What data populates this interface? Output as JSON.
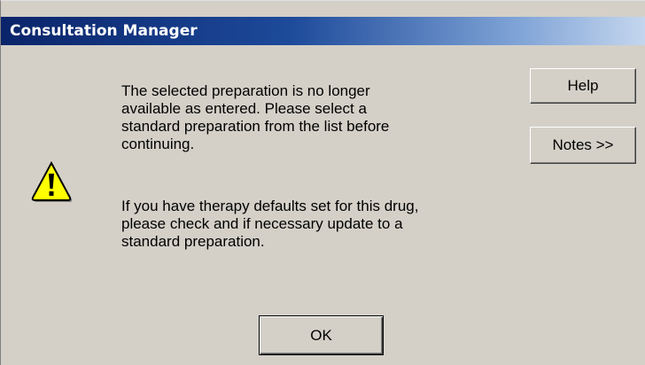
{
  "window": {
    "title": "Consultation Manager"
  },
  "dialog": {
    "icon": "warning-icon",
    "message_1": "The selected preparation is no longer\navailable as entered. Please select a\nstandard preparation from the list before\ncontinuing.",
    "message_2": "If you have therapy defaults set for this drug,\nplease check and if necessary update to a\nstandard preparation."
  },
  "buttons": {
    "help": "Help",
    "notes": "Notes >>",
    "ok": "OK"
  },
  "colors": {
    "titlebar_start": "#0a246a",
    "titlebar_end": "#c4d6ee",
    "face": "#d4d0c8",
    "warning_yellow": "#ffff00"
  }
}
